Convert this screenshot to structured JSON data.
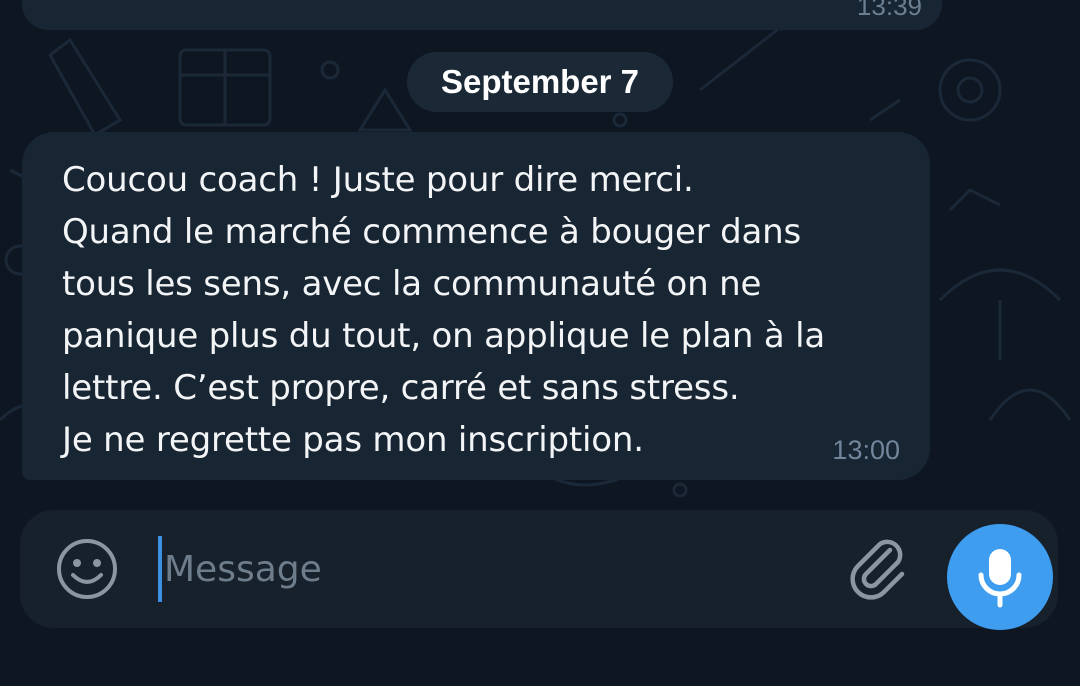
{
  "previous_message": {
    "time": "13:39"
  },
  "date_separator": "September 7",
  "message": {
    "text": "Coucou coach ! Juste pour dire merci.\nQuand le marché commence à bouger dans\ntous les sens, avec la communauté on ne\npanique plus du tout, on applique le plan à la\nlettre. C’est propre, carré et sans stress.\nJe ne regrette pas mon inscription.",
    "time": "13:00"
  },
  "composer": {
    "placeholder": "Message",
    "value": "",
    "emoji_icon": "smiley-icon",
    "attach_icon": "paperclip-icon",
    "mic_icon": "microphone-icon"
  },
  "colors": {
    "background": "#0e1621",
    "bubble": "#182533",
    "composer": "#17212b",
    "accent": "#3f9df0",
    "caret": "#3d8fe0"
  }
}
